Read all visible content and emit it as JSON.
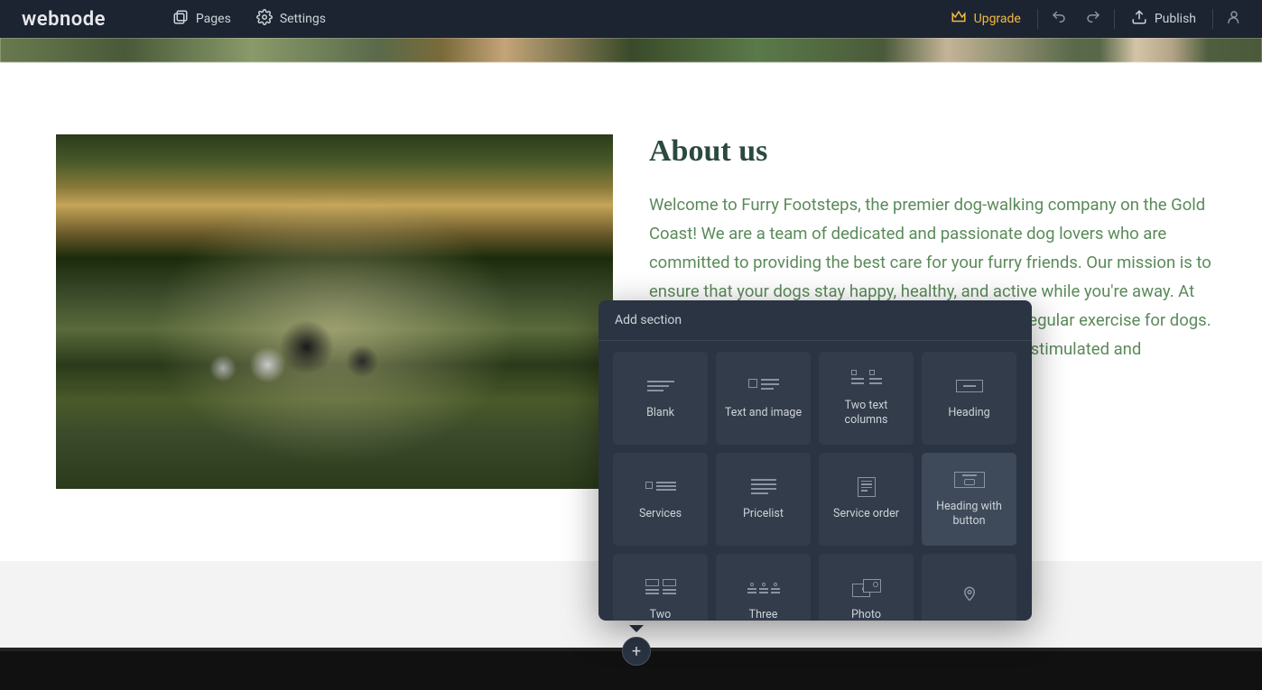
{
  "brand": "webnode",
  "toolbar": {
    "pages": "Pages",
    "settings": "Settings",
    "upgrade": "Upgrade",
    "publish": "Publish"
  },
  "about": {
    "title": "About us",
    "body": "Welcome to Furry Footsteps, the premier dog-walking company on the Gold Coast! We are a team of dedicated and passionate dog lovers who are committed to providing the best care for your furry friends. Our mission is to ensure that your dogs stay happy, healthy, and active while you're away. At Furry Footsteps, we understand the importance of regular exercise for dogs. We offer daily walks, rain or shine, to keep your pup stimulated and engaged."
  },
  "popover": {
    "title": "Add section",
    "sections": [
      {
        "key": "blank",
        "label": "Blank"
      },
      {
        "key": "text-and-image",
        "label": "Text and image"
      },
      {
        "key": "two-text-columns",
        "label": "Two text columns"
      },
      {
        "key": "heading",
        "label": "Heading"
      },
      {
        "key": "services",
        "label": "Services"
      },
      {
        "key": "pricelist",
        "label": "Pricelist"
      },
      {
        "key": "service-order",
        "label": "Service order"
      },
      {
        "key": "heading-with-button",
        "label": "Heading with button"
      },
      {
        "key": "two",
        "label": "Two"
      },
      {
        "key": "three",
        "label": "Three"
      },
      {
        "key": "photo",
        "label": "Photo"
      },
      {
        "key": "map",
        "label": ""
      }
    ],
    "hovered_index": 7
  },
  "colors": {
    "toolbar_bg": "#1c2432",
    "popover_bg": "#2a3442",
    "card_bg": "#323c4a",
    "card_hover_bg": "#3e4a5a",
    "accent_upgrade": "#f3b93e",
    "heading_text": "#2b4a3f",
    "body_text": "#5a8a5a"
  }
}
